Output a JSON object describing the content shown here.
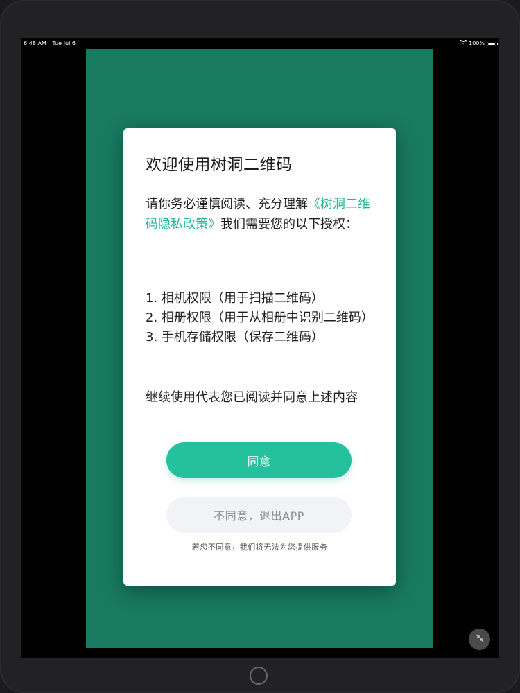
{
  "status_bar": {
    "time": "6:48 AM",
    "date": "Tue Jul 6",
    "battery_text": "100%",
    "battery_level": 1.0,
    "wifi_icon": "wifi-icon",
    "battery_icon": "battery-icon"
  },
  "dialog": {
    "title": "欢迎使用树洞二维码",
    "intro_before": "请你务必谨慎阅读、充分理解",
    "policy_link": "《树洞二维码隐私政策》",
    "intro_after": "我们需要您的以下授权：",
    "permissions": [
      "1. 相机权限（用于扫描二维码）",
      "2. 相册权限（用于从相册中识别二维码）",
      "3. 手机存储权限（保存二维码）"
    ],
    "continue_note": "继续使用代表您已阅读并同意上述内容",
    "agree_label": "同意",
    "disagree_label": "不同意，退出APP",
    "footer_note": "若您不同意，我们将无法为您提供服务"
  },
  "colors": {
    "app_background": "#187a60",
    "accent": "#25c09c",
    "link": "#22b895",
    "secondary_button": "#f1f3f6"
  },
  "icons": {
    "minimize": "minimize-arrows-icon",
    "home": "home-button"
  }
}
